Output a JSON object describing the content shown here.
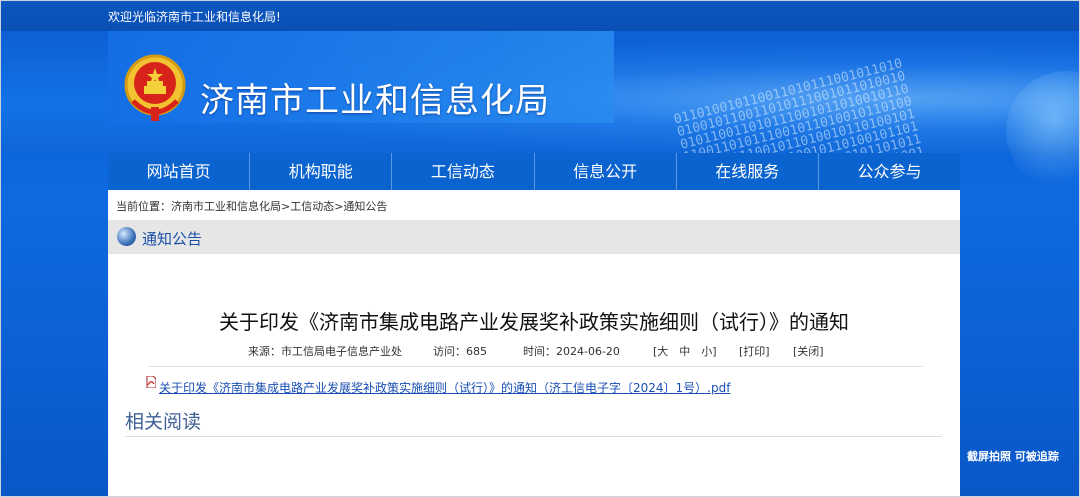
{
  "topbar": {
    "welcome": "欢迎光临济南市工业和信息化局!"
  },
  "header": {
    "title": "济南市工业和信息化局",
    "binary_text": "0110100101100110101110010110100101101001011010110011010110010110100101110100101100101101001011010010110101101001"
  },
  "nav": {
    "items": [
      "网站首页",
      "机构职能",
      "工信动态",
      "信息公开",
      "在线服务",
      "公众参与"
    ]
  },
  "breadcrumb": {
    "text": "当前位置：济南市工业和信息化局>工信动态>通知公告"
  },
  "section": {
    "title": "通知公告"
  },
  "article": {
    "title": "关于印发《济南市集成电路产业发展奖补政策实施细则（试行）》的通知",
    "source": "来源：市工信局电子信息产业处",
    "visits": "访问：685",
    "time": "时间：2024-06-20",
    "font_size_controls": "[大　中　小]",
    "print": "[打印]",
    "close": "[关闭]",
    "attachment": "关于印发《济南市集成电路产业发展奖补政策实施细则（试行）》的通知（济工信电子字〔2024〕1号）.pdf"
  },
  "related": {
    "title": "相关阅读"
  },
  "watermark": "截屏拍照 可被追踪",
  "colors": {
    "primary_blue": "#0b63cf",
    "link_blue": "#1a4fb5",
    "section_title": "#1c4fa8"
  }
}
